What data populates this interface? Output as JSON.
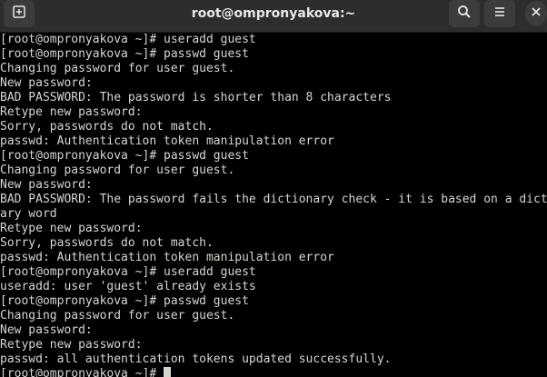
{
  "window": {
    "title": "root@ompronyakova:~"
  },
  "toolbar": {
    "new_tab_icon": "new-tab-icon",
    "search_icon": "search-icon",
    "menu_icon": "hamburger-menu-icon",
    "close_icon": "close-icon"
  },
  "terminal": {
    "lines": [
      "[root@ompronyakova ~]# useradd guest",
      "[root@ompronyakova ~]# passwd guest",
      "Changing password for user guest.",
      "New password:",
      "BAD PASSWORD: The password is shorter than 8 characters",
      "Retype new password:",
      "Sorry, passwords do not match.",
      "passwd: Authentication token manipulation error",
      "[root@ompronyakova ~]# passwd guest",
      "Changing password for user guest.",
      "New password:",
      "BAD PASSWORD: The password fails the dictionary check - it is based on a diction",
      "ary word",
      "Retype new password:",
      "Sorry, passwords do not match.",
      "passwd: Authentication token manipulation error",
      "[root@ompronyakova ~]# useradd guest",
      "useradd: user 'guest' already exists",
      "[root@ompronyakova ~]# passwd guest",
      "Changing password for user guest.",
      "New password:",
      "Retype new password:",
      "passwd: all authentication tokens updated successfully."
    ],
    "prompt": "[root@ompronyakova ~]# "
  }
}
